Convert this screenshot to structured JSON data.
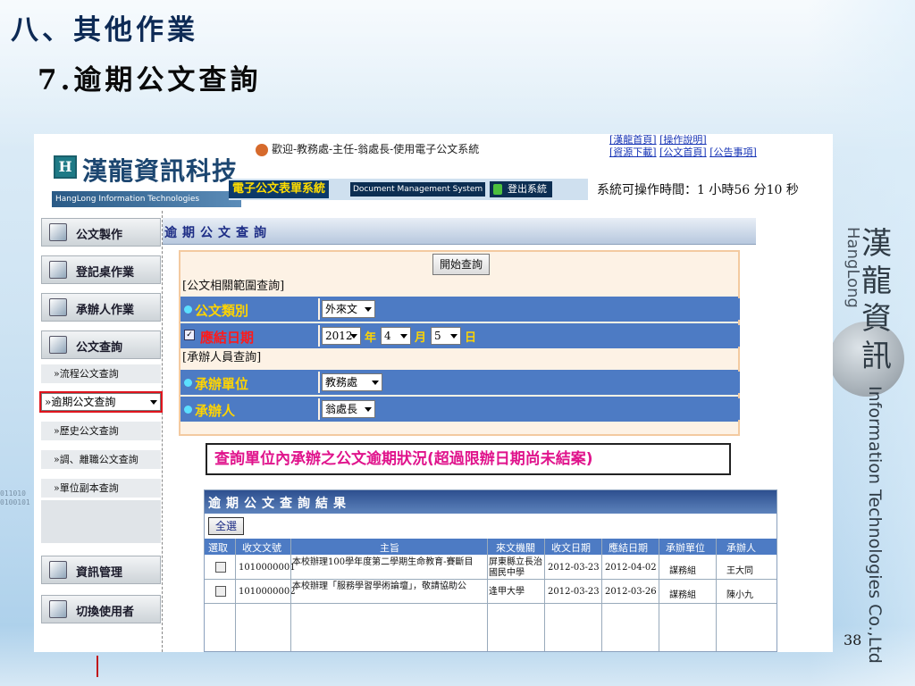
{
  "slide": {
    "title": "八、其他作業",
    "subtitle": "7.逾期公文查詢",
    "page_number": "38",
    "brand_vertical_cn": [
      "漢",
      "龍",
      "資",
      "訊"
    ],
    "brand_vertical_en1": "HangLong",
    "brand_vertical_en2": "Information Technologies Co.,Ltd",
    "binary_text": [
      "011010",
      "0100101"
    ]
  },
  "header": {
    "logo_box": "H",
    "logo_cn": "漢龍資訊科技",
    "logo_en": "HangLong Information Technologies",
    "welcome": "歡迎-教務處-主任-翁處長-使用電子公文系統",
    "system_name": "電子公文表單系統",
    "system_en": "Document Management System",
    "logout": "登出系統",
    "links_row1": [
      "[漢龍首頁]",
      "[操作說明]"
    ],
    "links_row2": [
      "[資源下載]",
      "[公文首頁]",
      "[公告事項]"
    ],
    "timer": "系統可操作時間：1 小時56 分10 秒"
  },
  "sidebar": {
    "items": [
      {
        "label": "公文製作",
        "icon": "document-icon"
      },
      {
        "label": "登記桌作業",
        "icon": "desk-icon"
      },
      {
        "label": "承辦人作業",
        "icon": "person-icon"
      },
      {
        "label": "公文查詢",
        "icon": "search-doc-icon"
      }
    ],
    "sub_items": [
      "»流程公文查詢",
      "»逾期公文查詢",
      "»歷史公文查詢",
      "»調、離職公文查詢",
      "»單位副本查詢"
    ],
    "bottom_items": [
      {
        "label": "資訊管理",
        "icon": "network-icon"
      },
      {
        "label": "切換使用者",
        "icon": "switch-user-icon"
      }
    ]
  },
  "panel": {
    "title": "逾期公文查詢",
    "start_button": "開始查詢",
    "section1": "[公文相關範圍查詢]",
    "doc_type_label": "公文類別",
    "doc_type_value": "外來文",
    "due_label": "應結日期",
    "year_value": "2012",
    "year_unit": "年",
    "month_value": "4",
    "month_unit": "月",
    "day_value": "5",
    "day_unit": "日",
    "section2": "[承辦人員查詢]",
    "unit_label": "承辦單位",
    "unit_value": "教務處",
    "person_label": "承辦人",
    "person_value": "翁處長"
  },
  "callout": "查詢單位內承辦之公文逾期狀況(超過限辦日期尚未結案)",
  "results": {
    "title": "逾期公文查詢結果",
    "select_all": "全選",
    "columns": [
      "選取",
      "收文文號",
      "主旨",
      "來文機關",
      "收文日期",
      "應結日期",
      "承辦單位",
      "承辦人"
    ],
    "rows": [
      {
        "no": "1010000001",
        "subject": "本校辦理100學年度第二學期生命教育-賽斷目",
        "org": "屏東縣立長治國民中學",
        "recv": "2012-03-23",
        "due": "2012-04-02",
        "unit": "謀務組",
        "person": "王大同"
      },
      {
        "no": "1010000002",
        "subject": "本校辦理「服務學習學術論壇」，敬請協助公",
        "org": "逢甲大學",
        "recv": "2012-03-23",
        "due": "2012-03-26",
        "unit": "謀務組",
        "person": "陳小九"
      }
    ]
  }
}
